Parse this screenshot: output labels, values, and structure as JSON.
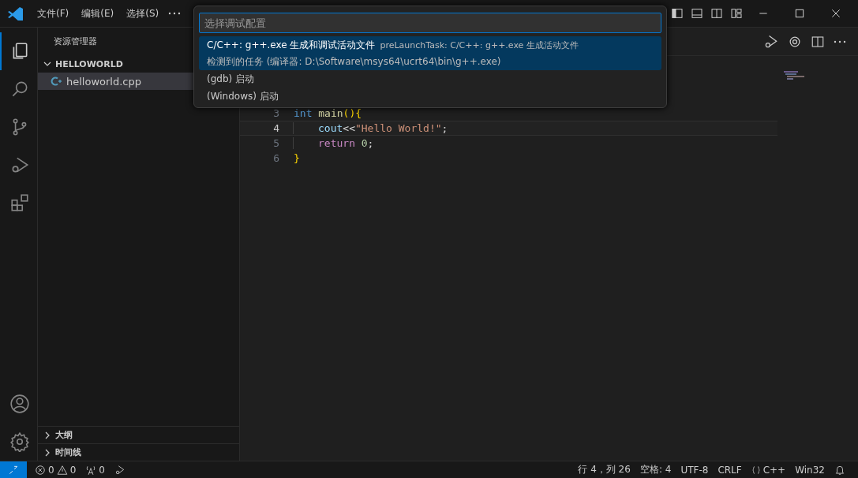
{
  "menu": [
    "文件(F)",
    "编辑(E)",
    "选择(S)"
  ],
  "sidebar": {
    "title": "资源管理器",
    "folder": {
      "label": "HELLOWORLD",
      "expanded": true,
      "files": [
        {
          "name": "helloworld.cpp",
          "selected": true
        }
      ]
    },
    "sections": [
      {
        "label": "大纲",
        "expanded": false
      },
      {
        "label": "时间线",
        "expanded": false
      }
    ]
  },
  "editor": {
    "lines": [
      {
        "number": "3",
        "active": false,
        "indented": false,
        "tokens": [
          {
            "text": "int",
            "kind": "keyword"
          },
          {
            "text": "main",
            "kind": "function",
            "space": true
          },
          {
            "text": "(){",
            "kind": "bracket"
          }
        ]
      },
      {
        "number": "4",
        "active": true,
        "indented": true,
        "tokens": [
          {
            "text": "cout",
            "kind": "variable"
          },
          {
            "text": "<<",
            "kind": "plain"
          },
          {
            "text": "\"Hello World!\"",
            "kind": "string"
          },
          {
            "text": ";",
            "kind": "plain"
          }
        ]
      },
      {
        "number": "5",
        "active": false,
        "indented": true,
        "tokens": [
          {
            "text": "return",
            "kind": "control"
          },
          {
            "text": "0",
            "kind": "number",
            "space": true
          },
          {
            "text": ";",
            "kind": "plain"
          }
        ]
      },
      {
        "number": "6",
        "active": false,
        "indented": false,
        "tokens": [
          {
            "text": "}",
            "kind": "bracket"
          }
        ]
      }
    ]
  },
  "palette": {
    "placeholder": "选择调试配置",
    "items": [
      {
        "label": "C/C++: g++.exe 生成和调试活动文件",
        "description": "preLaunchTask: C/C++: g++.exe 生成活动文件",
        "detail": "检测到的任务 (编译器: D:\\Software\\msys64\\ucrt64\\bin\\g++.exe)",
        "selected": true
      },
      {
        "label": "(gdb) 启动",
        "selected": false
      },
      {
        "label": "(Windows) 启动",
        "selected": false
      }
    ]
  },
  "status_bar": {
    "errors": "0",
    "warnings": "0",
    "ports": "0",
    "position": "行 4，列 26",
    "indent": "空格: 4",
    "encoding": "UTF-8",
    "eol": "CRLF",
    "language": "C++",
    "platform": "Win32"
  }
}
